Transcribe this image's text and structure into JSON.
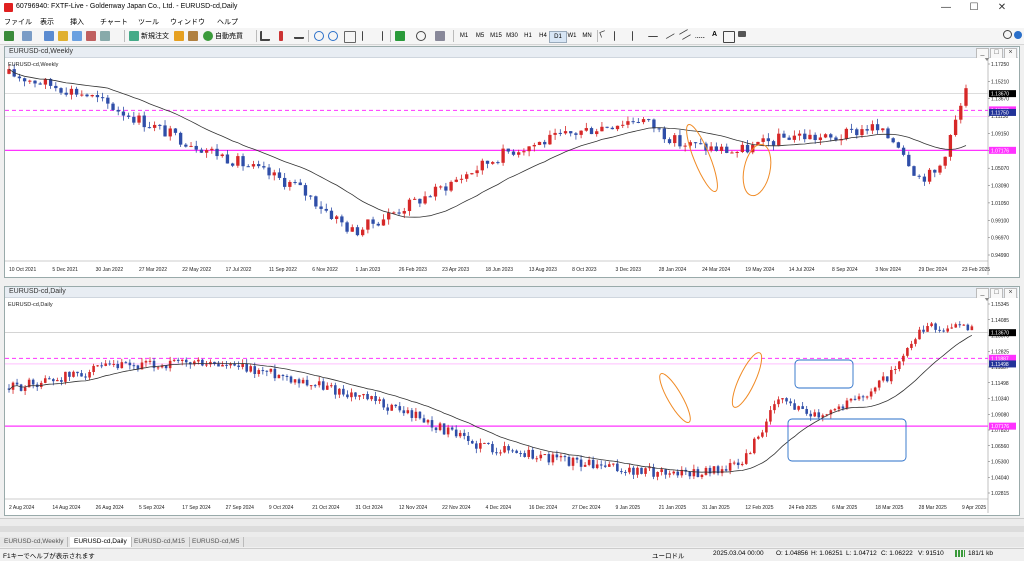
{
  "window": {
    "title": "60796940: FXTF-Live - Goldenway Japan Co., Ltd. - EURUSD-cd,Daily",
    "min": "—",
    "max": "☐",
    "close": "✕"
  },
  "menu": [
    "ファイル",
    "表示",
    "挿入",
    "チャート",
    "ツール",
    "ウィンドウ",
    "ヘルプ"
  ],
  "toolbar": {
    "new_order": "新規注文",
    "auto_trading": "自動売買",
    "timeframes": [
      "M1",
      "M5",
      "M15",
      "M30",
      "H1",
      "H4",
      "D1",
      "W1",
      "MN"
    ],
    "active_timeframe": "D1"
  },
  "weekly": {
    "window_title": "EURUSD-cd,Weekly",
    "label": "EURUSD-cd,Weekly",
    "price_labels": [
      "1.17250",
      "1.15210",
      "1.13670",
      "1.11130",
      "1.09150",
      "1.07176",
      "1.05070",
      "1.03090",
      "1.01050",
      "0.99100",
      "0.96970",
      "0.94990"
    ],
    "marked_prices": [
      "1.13670",
      "1.11887",
      "1.11750",
      "1.07176"
    ],
    "x_labels": [
      "10 Oct 2021",
      "5 Dec 2021",
      "30 Jan 2022",
      "27 Mar 2022",
      "22 May 2022",
      "17 Jul 2022",
      "11 Sep 2022",
      "6 Nov 2022",
      "1 Jan 2023",
      "26 Feb 2023",
      "23 Apr 2023",
      "18 Jun 2023",
      "13 Aug 2023",
      "8 Oct 2023",
      "3 Dec 2023",
      "28 Jan 2024",
      "24 Mar 2024",
      "19 May 2024",
      "14 Jul 2024",
      "8 Sep 2024",
      "3 Nov 2024",
      "29 Dec 2024",
      "23 Feb 2025"
    ]
  },
  "daily": {
    "window_title": "EURUSD-cd,Daily",
    "label": "EURUSD-cd,Daily",
    "price_labels": [
      "1.15345",
      "1.14085",
      "1.13670",
      "1.12825",
      "1.11887",
      "1.11498",
      "1.10340",
      "1.09080",
      "1.07820",
      "1.06560",
      "1.05300",
      "1.04040",
      "1.02815"
    ],
    "marked_prices": [
      "1.13670",
      "1.11887",
      "1.11498",
      "1.07176"
    ],
    "x_labels": [
      "2 Aug 2024",
      "14 Aug 2024",
      "26 Aug 2024",
      "5 Sep 2024",
      "17 Sep 2024",
      "27 Sep 2024",
      "9 Oct 2024",
      "21 Oct 2024",
      "31 Oct 2024",
      "12 Nov 2024",
      "22 Nov 2024",
      "4 Dec 2024",
      "16 Dec 2024",
      "27 Dec 2024",
      "9 Jan 2025",
      "21 Jan 2025",
      "31 Jan 2025",
      "12 Feb 2025",
      "24 Feb 2025",
      "6 Mar 2025",
      "18 Mar 2025",
      "28 Mar 2025",
      "9 Apr 2025"
    ]
  },
  "tabs": [
    "EURUSD-cd,Weekly",
    "EURUSD-cd,Daily",
    "EURUSD-cd,M15",
    "EURUSD-cd,M5"
  ],
  "active_tab": "EURUSD-cd,Daily",
  "status": {
    "help": "F1キーでヘルプが表示されます",
    "profile": "ユーロドル",
    "datetime": "2025.03.04 00:00",
    "open": "O: 1.04856",
    "high": "H: 1.06251",
    "low": "L: 1.04712",
    "close": "C: 1.06222",
    "volume": "V: 91510",
    "traffic": "181/1 kb"
  },
  "colors": {
    "bull": "#d62828",
    "bear": "#2f4ea8",
    "level_line": "#ff33ff",
    "ma_line": "#333333",
    "annot_orange": "#f08a24",
    "annot_blue": "#2a6fc9"
  }
}
